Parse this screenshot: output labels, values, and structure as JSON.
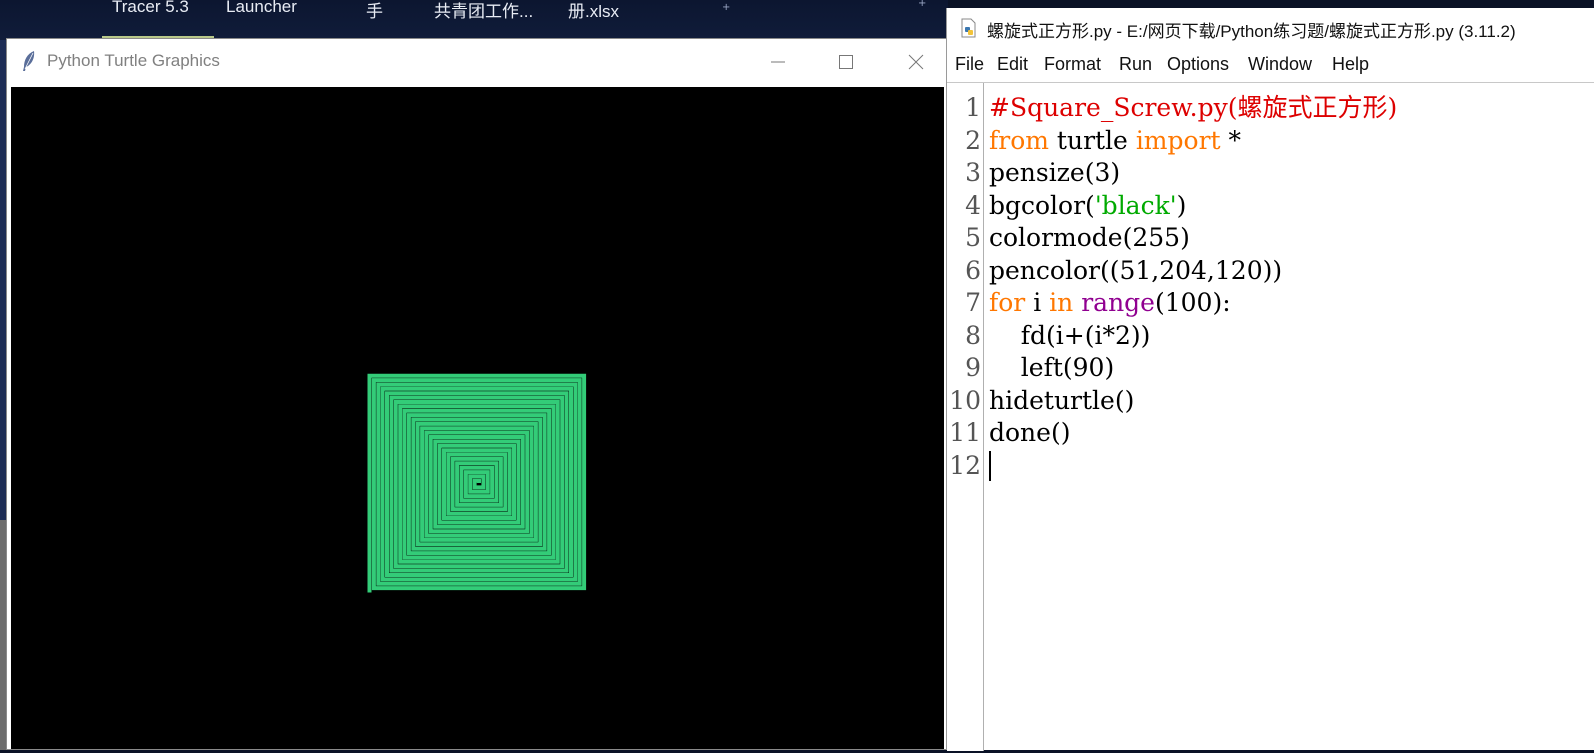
{
  "taskbar": {
    "items": [
      "Tracer 5.3",
      "Launcher",
      "手",
      "共青团工作...",
      "册.xlsx"
    ]
  },
  "turtle_window": {
    "title": "Python Turtle Graphics",
    "canvas_background": "#000000",
    "pen_color": "#33cc78",
    "icons": [
      "feather-icon",
      "minimize-icon",
      "maximize-icon",
      "close-icon"
    ]
  },
  "editor_window": {
    "title": "螺旋式正方形.py - E:/网页下载/Python练习题/螺旋式正方形.py (3.11.2)",
    "menu": [
      "File",
      "Edit",
      "Format",
      "Run",
      "Options",
      "Window",
      "Help"
    ],
    "line_numbers": [
      "1",
      "2",
      "3",
      "4",
      "5",
      "6",
      "7",
      "8",
      "9",
      "10",
      "11",
      "12"
    ],
    "code_lines": [
      [
        {
          "t": "#Square_Screw.py(螺旋式正方形)",
          "c": "comment"
        }
      ],
      [
        {
          "t": "from",
          "c": "keyword"
        },
        {
          "t": " turtle ",
          "c": "plain"
        },
        {
          "t": "import",
          "c": "keyword"
        },
        {
          "t": " *",
          "c": "plain"
        }
      ],
      [
        {
          "t": "pensize(3)",
          "c": "plain"
        }
      ],
      [
        {
          "t": "bgcolor(",
          "c": "plain"
        },
        {
          "t": "'black'",
          "c": "string"
        },
        {
          "t": ")",
          "c": "plain"
        }
      ],
      [
        {
          "t": "colormode(255)",
          "c": "plain"
        }
      ],
      [
        {
          "t": "pencolor((51,204,120))",
          "c": "plain"
        }
      ],
      [
        {
          "t": "for",
          "c": "keyword"
        },
        {
          "t": " i ",
          "c": "plain"
        },
        {
          "t": "in",
          "c": "keyword"
        },
        {
          "t": " ",
          "c": "plain"
        },
        {
          "t": "range",
          "c": "builtin"
        },
        {
          "t": "(100):",
          "c": "plain"
        }
      ],
      [
        {
          "t": "    fd(i+(i*2))",
          "c": "plain"
        }
      ],
      [
        {
          "t": "    left(90)",
          "c": "plain"
        }
      ],
      [
        {
          "t": "hideturtle()",
          "c": "plain"
        }
      ],
      [
        {
          "t": "done()",
          "c": "plain"
        }
      ],
      [
        {
          "t": "",
          "c": "plain"
        }
      ]
    ]
  }
}
